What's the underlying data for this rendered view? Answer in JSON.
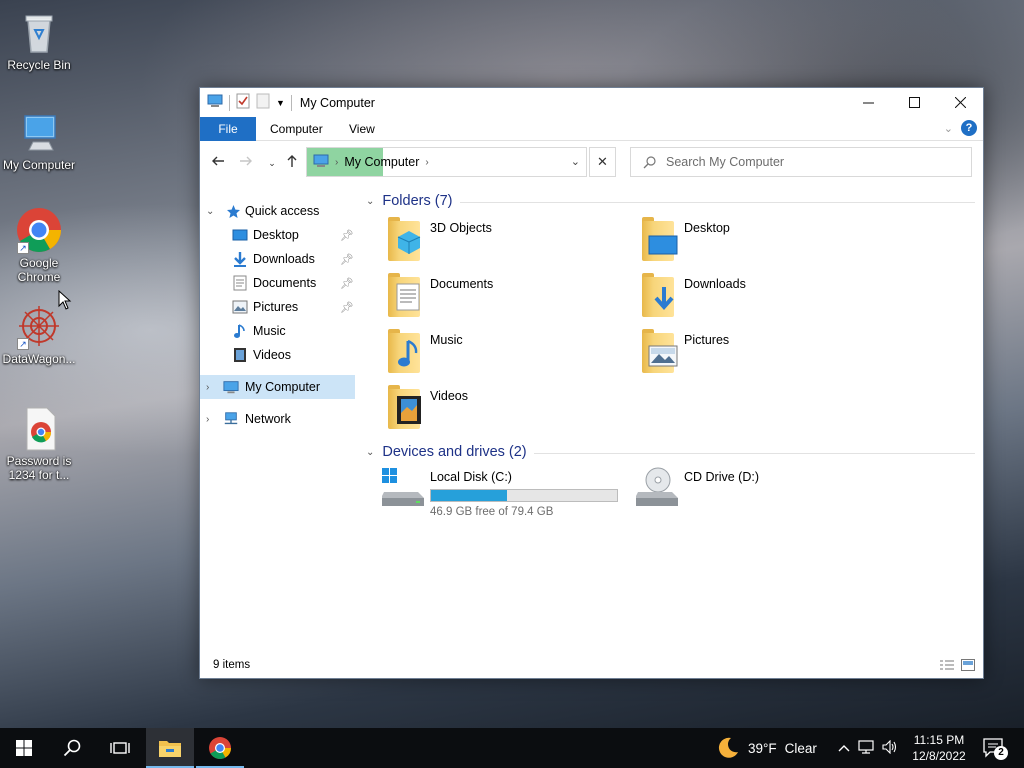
{
  "desktop": {
    "icons": [
      {
        "label": "Recycle Bin"
      },
      {
        "label": "My Computer"
      },
      {
        "label": "Google Chrome"
      },
      {
        "label": "DataWagon..."
      },
      {
        "label": "Password is 1234 for t..."
      }
    ]
  },
  "window": {
    "title": "My Computer",
    "ribbon_tabs": [
      "File",
      "Computer",
      "View"
    ],
    "help_label": "?",
    "address": {
      "crumbs": [
        "My Computer"
      ]
    },
    "search": {
      "placeholder": "Search My Computer"
    },
    "nav_pane": {
      "quick_access": "Quick access",
      "quick_items": [
        {
          "label": "Desktop",
          "pinned": true,
          "icon": "desktop-icon"
        },
        {
          "label": "Downloads",
          "pinned": true,
          "icon": "downloads-icon"
        },
        {
          "label": "Documents",
          "pinned": true,
          "icon": "documents-icon"
        },
        {
          "label": "Pictures",
          "pinned": true,
          "icon": "pictures-icon"
        },
        {
          "label": "Music",
          "pinned": false,
          "icon": "music-icon"
        },
        {
          "label": "Videos",
          "pinned": false,
          "icon": "videos-icon"
        }
      ],
      "my_computer": "My Computer",
      "network": "Network"
    },
    "folders_header": "Folders (7)",
    "folders": [
      {
        "label": "3D Objects",
        "icon": "3d-objects-folder-icon"
      },
      {
        "label": "Desktop",
        "icon": "desktop-folder-icon"
      },
      {
        "label": "Documents",
        "icon": "documents-folder-icon"
      },
      {
        "label": "Downloads",
        "icon": "downloads-folder-icon"
      },
      {
        "label": "Music",
        "icon": "music-folder-icon"
      },
      {
        "label": "Pictures",
        "icon": "pictures-folder-icon"
      },
      {
        "label": "Videos",
        "icon": "videos-folder-icon"
      }
    ],
    "devices_header": "Devices and drives (2)",
    "drives": [
      {
        "label": "Local Disk (C:)",
        "free_text": "46.9 GB free of 79.4 GB",
        "used_fraction": 0.41
      },
      {
        "label": "CD Drive (D:)"
      }
    ],
    "status": "9 items"
  },
  "taskbar": {
    "weather_temp": "39°F",
    "weather_desc": "Clear",
    "time": "11:15 PM",
    "date": "12/8/2022",
    "notifications": "2"
  },
  "colors": {
    "accent": "#1f6fc5",
    "selection": "#cce4f7",
    "address_highlight": "#8fd4a1",
    "drive_fill": "#26a0da"
  }
}
